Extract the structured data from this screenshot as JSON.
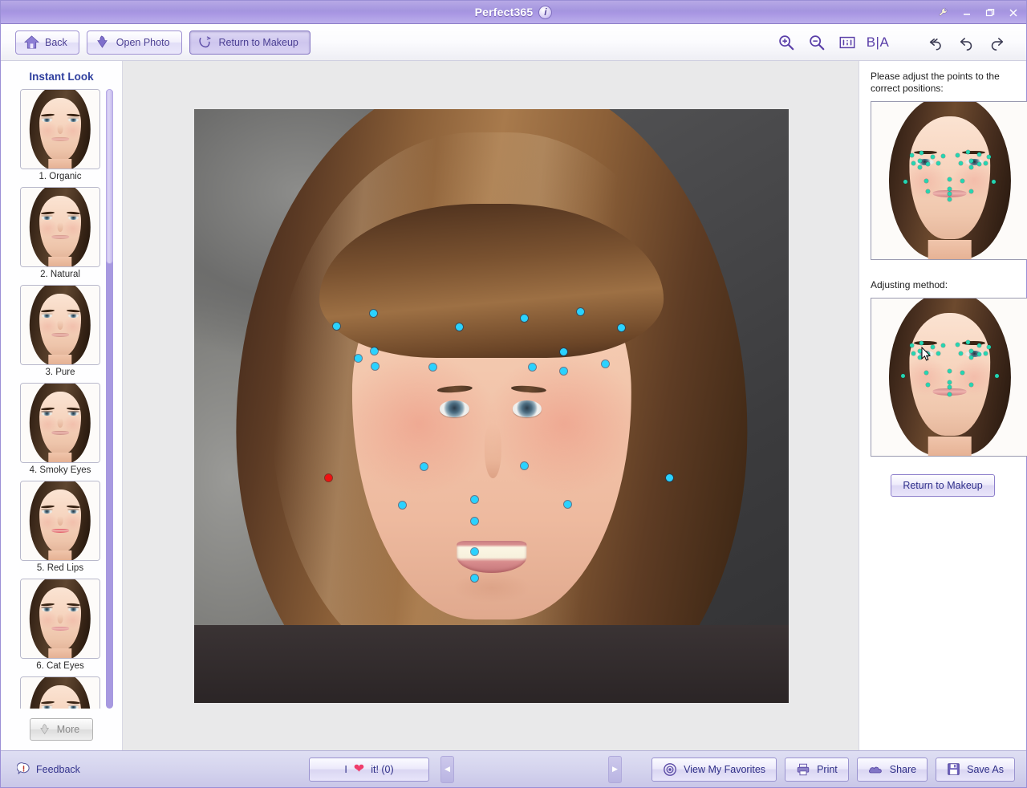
{
  "window": {
    "title": "Perfect365",
    "info_icon": "info-icon",
    "controls": [
      {
        "name": "settings-wrench-icon",
        "glyph": "⚒"
      },
      {
        "name": "minimize-button",
        "glyph": "–"
      },
      {
        "name": "maximize-button",
        "glyph": "❐"
      },
      {
        "name": "close-button",
        "glyph": "✕"
      }
    ]
  },
  "toolbar": {
    "back_label": "Back",
    "open_photo_label": "Open Photo",
    "return_to_makeup_label": "Return to Makeup",
    "zoom_in_name": "zoom-in-icon",
    "zoom_out_name": "zoom-out-icon",
    "actual_size_label": "1:1",
    "before_after_label": "B|A",
    "undo_all_name": "undo-all-icon",
    "undo_name": "undo-icon",
    "redo_name": "redo-icon"
  },
  "sidebar": {
    "title": "Instant Look",
    "more_label": "More",
    "looks": [
      {
        "label": "1. Organic"
      },
      {
        "label": "2. Natural"
      },
      {
        "label": "3. Pure"
      },
      {
        "label": "4. Smoky Eyes"
      },
      {
        "label": "5. Red Lips"
      },
      {
        "label": "6. Cat Eyes"
      },
      {
        "label": ""
      }
    ]
  },
  "canvas": {
    "mode": "face-point-adjustment",
    "point_color": "#2ad2ff",
    "selected_point_color": "#ef1111",
    "points": [
      {
        "id": "brow-l-outer",
        "x": 24.0,
        "y": 36.6,
        "selected": false
      },
      {
        "id": "brow-l-top",
        "x": 30.2,
        "y": 34.5,
        "selected": false
      },
      {
        "id": "brow-l-inner",
        "x": 44.6,
        "y": 36.8,
        "selected": false
      },
      {
        "id": "brow-r-inner",
        "x": 55.5,
        "y": 35.3,
        "selected": false
      },
      {
        "id": "brow-r-top",
        "x": 65.0,
        "y": 34.2,
        "selected": false
      },
      {
        "id": "brow-r-outer",
        "x": 71.8,
        "y": 36.9,
        "selected": false
      },
      {
        "id": "eye-l-top",
        "x": 30.3,
        "y": 40.8,
        "selected": false
      },
      {
        "id": "eye-l-outer",
        "x": 27.6,
        "y": 42.0,
        "selected": false
      },
      {
        "id": "eye-l-bottom",
        "x": 30.4,
        "y": 43.4,
        "selected": false
      },
      {
        "id": "eye-l-inner",
        "x": 40.2,
        "y": 43.5,
        "selected": false
      },
      {
        "id": "eye-r-top",
        "x": 62.2,
        "y": 40.9,
        "selected": false
      },
      {
        "id": "eye-r-inner",
        "x": 56.9,
        "y": 43.5,
        "selected": false
      },
      {
        "id": "eye-r-bottom",
        "x": 62.1,
        "y": 44.2,
        "selected": false
      },
      {
        "id": "eye-r-outer",
        "x": 69.2,
        "y": 43.0,
        "selected": false
      },
      {
        "id": "nose-l",
        "x": 38.6,
        "y": 60.3,
        "selected": false
      },
      {
        "id": "nose-r",
        "x": 55.5,
        "y": 60.2,
        "selected": false
      },
      {
        "id": "cheek-l",
        "x": 22.6,
        "y": 62.2,
        "selected": true
      },
      {
        "id": "cheek-r",
        "x": 79.9,
        "y": 62.2,
        "selected": false
      },
      {
        "id": "mouth-l",
        "x": 35.0,
        "y": 66.8,
        "selected": false
      },
      {
        "id": "mouth-top",
        "x": 47.2,
        "y": 65.8,
        "selected": false
      },
      {
        "id": "mouth-r",
        "x": 62.8,
        "y": 66.6,
        "selected": false
      },
      {
        "id": "mouth-inner",
        "x": 47.2,
        "y": 69.5,
        "selected": false
      },
      {
        "id": "lip-bottom",
        "x": 47.2,
        "y": 74.6,
        "selected": false
      },
      {
        "id": "chin-top",
        "x": 47.2,
        "y": 79.1,
        "selected": false
      }
    ]
  },
  "right_panel": {
    "instruction": "Please adjust the points to the correct positions:",
    "adjusting_method_label": "Adjusting method:",
    "return_to_makeup_label": "Return to Makeup",
    "guide_point_color": "#24d6b2"
  },
  "bottom_bar": {
    "feedback_label": "Feedback",
    "love_prefix": "I",
    "love_suffix": "it! (0)",
    "heart_icon": "heart-icon",
    "pager_prev": "◀",
    "pager_next": "▶",
    "view_favorites_label": "View My Favorites",
    "print_label": "Print",
    "share_label": "Share",
    "save_as_label": "Save As"
  },
  "theme": {
    "accent": "#a495df",
    "title_text": "#ffffff",
    "sidebar_title": "#2f3f9e",
    "button_text": "#2f2f87",
    "canvas_bg": "#e9e9ea"
  }
}
